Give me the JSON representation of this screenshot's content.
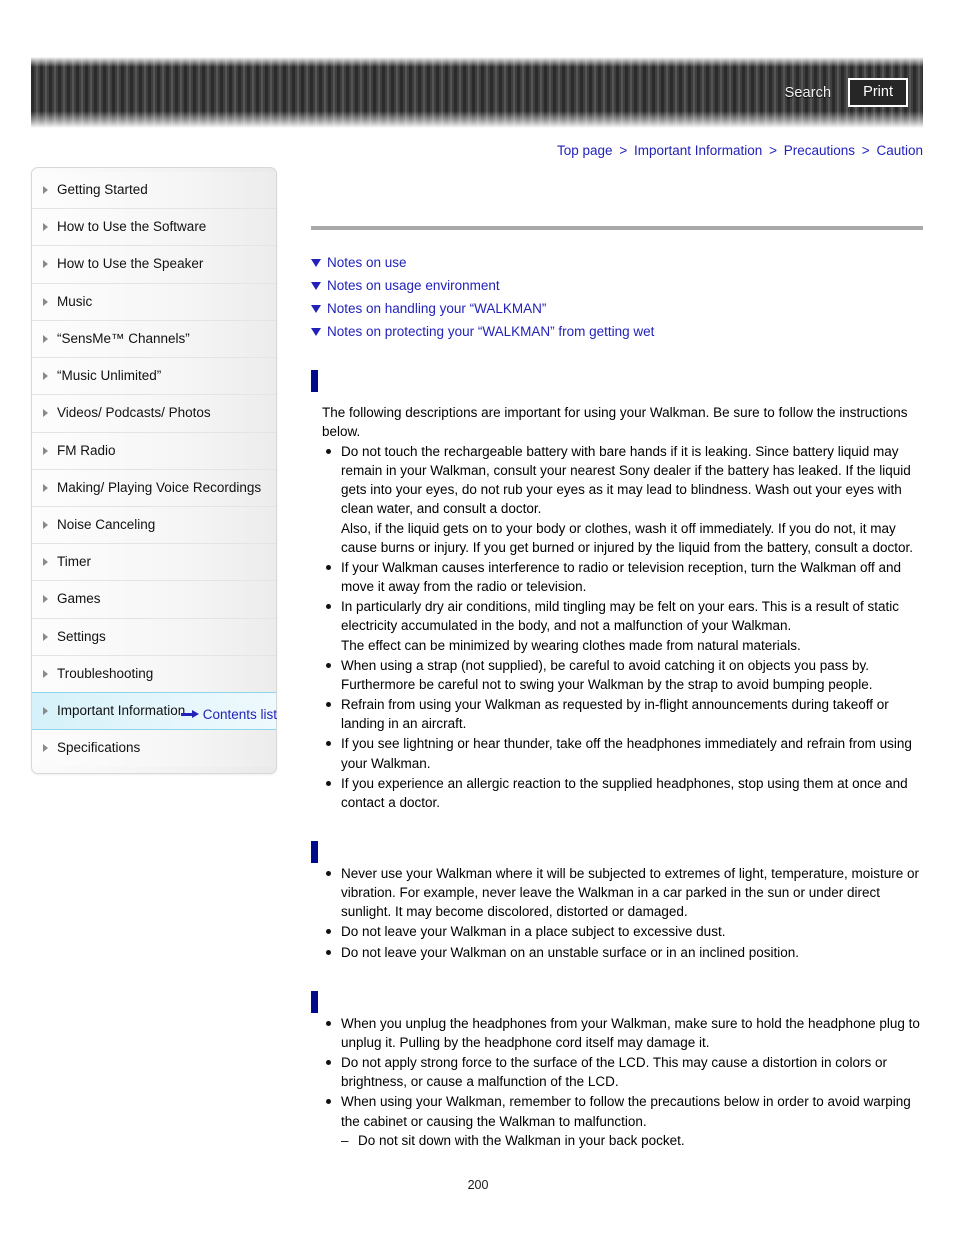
{
  "header": {
    "search_label": "Search",
    "print_label": "Print"
  },
  "breadcrumb": {
    "items": [
      {
        "label": "Top page"
      },
      {
        "label": "Important Information"
      },
      {
        "label": "Precautions"
      },
      {
        "label": "Caution"
      }
    ],
    "separator": ">"
  },
  "sidebar": {
    "items": [
      {
        "label": "Getting Started",
        "active": false
      },
      {
        "label": "How to Use the Software",
        "active": false
      },
      {
        "label": "How to Use the Speaker",
        "active": false
      },
      {
        "label": "Music",
        "active": false
      },
      {
        "label": "“SensMe™ Channels”",
        "active": false
      },
      {
        "label": "“Music Unlimited”",
        "active": false
      },
      {
        "label": "Videos/ Podcasts/ Photos",
        "active": false
      },
      {
        "label": "FM Radio",
        "active": false
      },
      {
        "label": "Making/ Playing Voice Recordings",
        "active": false
      },
      {
        "label": "Noise Canceling",
        "active": false
      },
      {
        "label": "Timer",
        "active": false
      },
      {
        "label": "Games",
        "active": false
      },
      {
        "label": "Settings",
        "active": false
      },
      {
        "label": "Troubleshooting",
        "active": false
      },
      {
        "label": "Important Information",
        "active": true
      },
      {
        "label": "Specifications",
        "active": false
      }
    ],
    "contents_list_label": "Contents list"
  },
  "main": {
    "anchor_links": [
      {
        "label": "Notes on use"
      },
      {
        "label": "Notes on usage environment"
      },
      {
        "label": "Notes on handling your “WALKMAN”"
      },
      {
        "label": "Notes on protecting your “WALKMAN” from getting wet"
      }
    ],
    "sections": [
      {
        "heading": "",
        "intro": "The following descriptions are important for using your Walkman. Be sure to follow the instructions below.",
        "bullets": [
          {
            "text": "Do not touch the rechargeable battery with bare hands if it is leaking. Since battery liquid may remain in your Walkman, consult your nearest Sony dealer if the battery has leaked. If the liquid gets into your eyes, do not rub your eyes as it may lead to blindness. Wash out your eyes with clean water, and consult a doctor.",
            "continuation": "Also, if the liquid gets on to your body or clothes, wash it off immediately. If you do not, it may cause burns or injury. If you get burned or injured by the liquid from the battery, consult a doctor."
          },
          {
            "text": "If your Walkman causes interference to radio or television reception, turn the Walkman off and move it away from the radio or television."
          },
          {
            "text": "In particularly dry air conditions, mild tingling may be felt on your ears. This is a result of static electricity accumulated in the body, and not a malfunction of your Walkman.",
            "continuation": "The effect can be minimized by wearing clothes made from natural materials."
          },
          {
            "text": "When using a strap (not supplied), be careful to avoid catching it on objects you pass by. Furthermore be careful not to swing your Walkman by the strap to avoid bumping people."
          },
          {
            "text": "Refrain from using your Walkman as requested by in-flight announcements during takeoff or landing in an aircraft."
          },
          {
            "text": "If you see lightning or hear thunder, take off the headphones immediately and refrain from using your Walkman."
          },
          {
            "text": "If you experience an allergic reaction to the supplied headphones, stop using them at once and contact a doctor."
          }
        ]
      },
      {
        "heading": "",
        "intro": "",
        "bullets": [
          {
            "text": "Never use your Walkman where it will be subjected to extremes of light, temperature, moisture or vibration. For example, never leave the Walkman in a car parked in the sun or under direct sunlight. It may become discolored, distorted or damaged."
          },
          {
            "text": "Do not leave your Walkman in a place subject to excessive dust."
          },
          {
            "text": "Do not leave your Walkman on an unstable surface or in an inclined position."
          }
        ]
      },
      {
        "heading": "",
        "intro": "",
        "bullets": [
          {
            "text": "When you unplug the headphones from your Walkman, make sure to hold the headphone plug to unplug it. Pulling by the headphone cord itself may damage it."
          },
          {
            "text": "Do not apply strong force to the surface of the LCD. This may cause a distortion in colors or brightness, or cause a malfunction of the LCD."
          },
          {
            "text": "When using your Walkman, remember to follow the precautions below in order to avoid warping the cabinet or causing the Walkman to malfunction.",
            "sub_items": [
              "Do not sit down with the Walkman in your back pocket."
            ]
          }
        ]
      }
    ]
  },
  "footer": {
    "page_number": "200"
  },
  "colors": {
    "link": "#2222bb",
    "heading_marker": "#000a8c",
    "active_nav": "#d6f1fa",
    "rule": "#a9a9a9"
  }
}
